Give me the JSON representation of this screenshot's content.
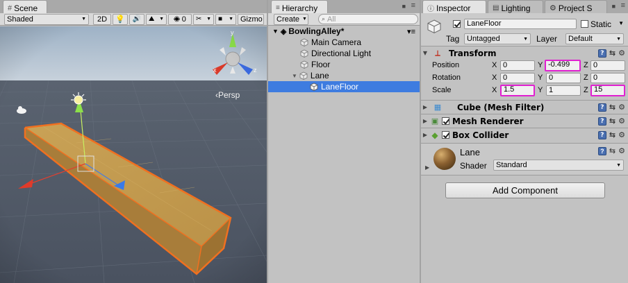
{
  "scene": {
    "tab_label": "Scene",
    "shading_mode": "Shaded",
    "toggle_2d": "2D",
    "gizmo_hidden_count": "0",
    "gizmos_label": "Gizmo",
    "persp_label": "‹Persp"
  },
  "hierarchy": {
    "tab_label": "Hierarchy",
    "create_label": "Create",
    "search_placeholder": "All",
    "scene_name": "BowlingAlley*",
    "items": [
      {
        "label": "Main Camera"
      },
      {
        "label": "Directional Light"
      },
      {
        "label": "Floor"
      },
      {
        "label": "Lane"
      },
      {
        "label": "LaneFloor"
      }
    ]
  },
  "inspector": {
    "tabs": [
      {
        "label": "Inspector"
      },
      {
        "label": "Lighting"
      },
      {
        "label": "Project S"
      }
    ],
    "object_name": "LaneFloor",
    "static_label": "Static",
    "tag_label": "Tag",
    "tag_value": "Untagged",
    "layer_label": "Layer",
    "layer_value": "Default",
    "transform": {
      "title": "Transform",
      "position_label": "Position",
      "rotation_label": "Rotation",
      "scale_label": "Scale",
      "axis_x": "X",
      "axis_y": "Y",
      "axis_z": "Z",
      "position": {
        "x": "0",
        "y": "-0.499",
        "z": "0"
      },
      "rotation": {
        "x": "0",
        "y": "0",
        "z": "0"
      },
      "scale": {
        "x": "1.5",
        "y": "1",
        "z": "15"
      }
    },
    "components": [
      {
        "title": "Cube (Mesh Filter)"
      },
      {
        "title": "Mesh Renderer"
      },
      {
        "title": "Box Collider"
      }
    ],
    "material": {
      "name": "Lane",
      "shader_label": "Shader",
      "shader_value": "Standard"
    },
    "add_component_label": "Add Component"
  },
  "colors": {
    "highlight": "#e020d0",
    "selection": "#3e7ce0",
    "lane_outline": "#f07020",
    "lane_fill": "#c8a050"
  }
}
